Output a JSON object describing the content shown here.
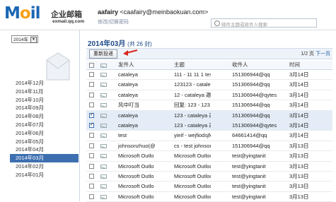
{
  "header": {
    "logo_word": "Mail",
    "logo_cn": "企业邮箱",
    "logo_sub": "exmail.qq.com",
    "user_name": "aafairy",
    "user_email": "<caafairy@meinbaokuan.com>",
    "user_links": "修改|切换密码",
    "search_placeholder": "邮件主题或收件人搜索"
  },
  "sidebar": {
    "year": "2014年",
    "months": [
      "2014年12月",
      "2014年11月",
      "2014年10月",
      "2014年09月",
      "2014年08月",
      "2014年07月",
      "2014年06月",
      "2014年05月",
      "2014年04月",
      "2014年03月",
      "2014年02月",
      "2014年01月"
    ],
    "active_month": "2014年03月"
  },
  "content": {
    "title": "2014年03月",
    "count": "(共 26 封)",
    "resend_label": "重新投递",
    "pager_text": "1/2 页",
    "pager_next": "下一页",
    "columns": {
      "sender": "发件人",
      "subject": "主题",
      "to": "收件人",
      "time": "时间"
    },
    "rows": [
      {
        "sender": "cataleya",
        "subject": "111 - 11 11 1 testc",
        "to": "151306944@qq",
        "time": "3月14日",
        "checked": false
      },
      {
        "sender": "cataleya",
        "subject": "123123 - cataleya",
        "to": "151306944@qq",
        "time": "3月14日",
        "checked": false
      },
      {
        "sender": "cataleya",
        "subject": "12 - cataleya 邀请您",
        "to": "151306944@qytes",
        "time": "3月14日",
        "checked": false
      },
      {
        "sender": "风中叮当",
        "subject": "回复: 123 - 123 123",
        "to": "151306944@qq",
        "time": "3月14日",
        "checked": false
      },
      {
        "sender": "cataleya",
        "subject": "123 - cataleya 邀请",
        "to": "151306944@qq",
        "time": "3月14日",
        "checked": true
      },
      {
        "sender": "cataleya",
        "subject": "123 - cataleya 邀请",
        "to": "151306944@qytes",
        "time": "3月14日",
        "checked": true
      },
      {
        "sender": "test",
        "subject": "yieif - wejfiodsjfejf",
        "to": "64661414@qq",
        "time": "3月14日",
        "checked": false
      },
      {
        "sender": "johnsonzhuo(@",
        "subject": "cs - test johnsonzhuo",
        "to": "151306944@qq",
        "time": "3月13日",
        "checked": false
      },
      {
        "sender": "Microsoft Outlo",
        "subject": "Microsoft Outlook",
        "to": "test@yingtanit",
        "time": "3月13日",
        "checked": false
      },
      {
        "sender": "Microsoft Outlo",
        "subject": "Microsoft Outlook",
        "to": "test@yingtanit",
        "time": "3月13日",
        "checked": false
      },
      {
        "sender": "Microsoft Outlo",
        "subject": "Microsoft Outlook",
        "to": "test@yingtanit",
        "time": "3月13日",
        "checked": false
      },
      {
        "sender": "Microsoft Outlo",
        "subject": "Microsoft Outlook",
        "to": "test@yingtanit",
        "time": "3月13日",
        "checked": false
      },
      {
        "sender": "Microsoft Outlo",
        "subject": "Microsoft Outlook",
        "to": "test@yingtanit",
        "time": "3月13日",
        "checked": false
      }
    ]
  },
  "colors": {
    "accent": "#3d6fb0",
    "logo_blue": "#1b66b3",
    "logo_orange": "#f7a21b",
    "arrow_red": "#d9261c"
  }
}
